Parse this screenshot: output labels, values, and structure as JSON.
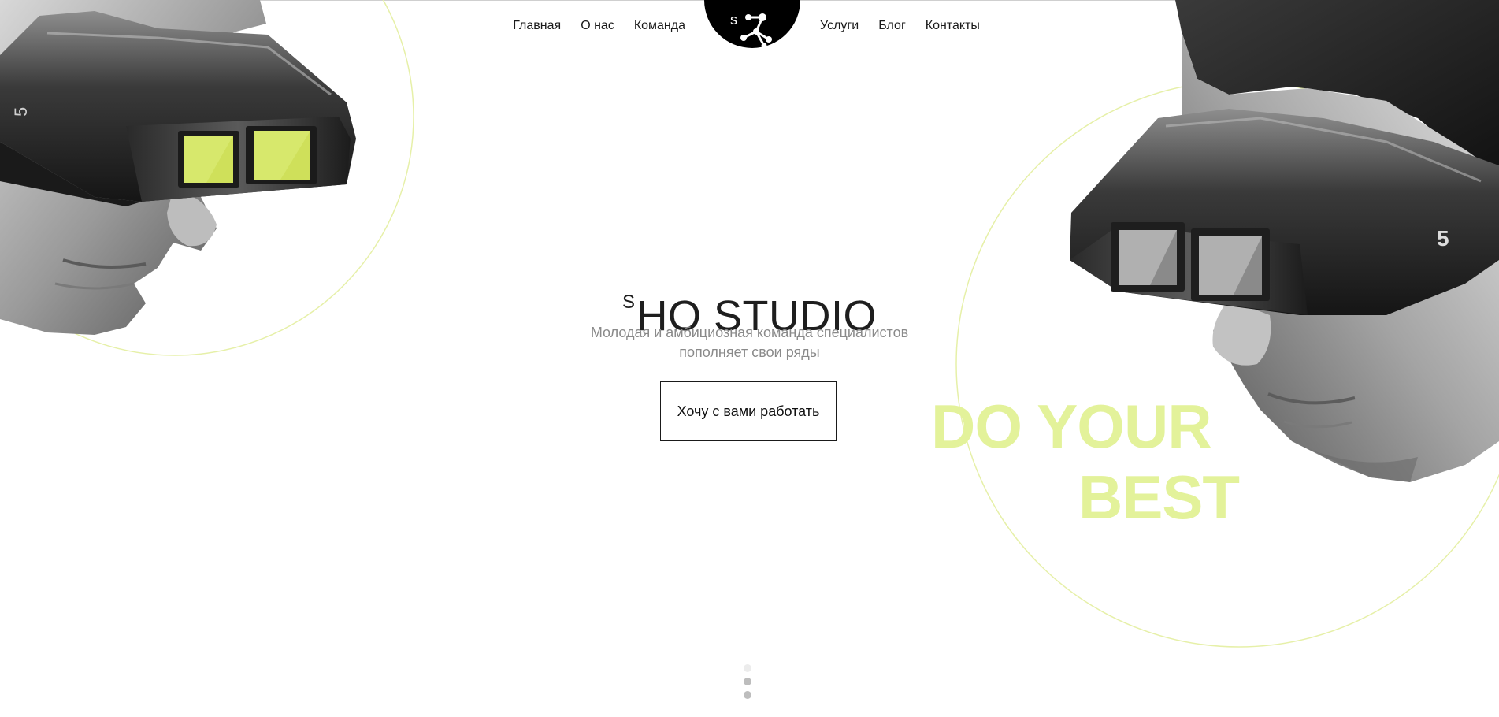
{
  "nav": {
    "left": [
      {
        "label": "Главная"
      },
      {
        "label": "О нас"
      },
      {
        "label": "Команда"
      }
    ],
    "right": [
      {
        "label": "Услуги"
      },
      {
        "label": "Блог"
      },
      {
        "label": "Контакты"
      }
    ]
  },
  "logo": {
    "letter": "s",
    "icon": "network-nodes-icon"
  },
  "hero": {
    "title_sup": "S",
    "title": "HO STUDIO",
    "subtitle_line1": "Молодая и амбициозная команда специалистов",
    "subtitle_line2": "пополняет свои ряды",
    "cta_label": "Хочу с вами работать"
  },
  "slogan": {
    "line1": "DO YOUR",
    "line2": "BEST"
  },
  "pager": {
    "count": 3,
    "active_index": 0
  },
  "colors": {
    "accent": "#e3f29a",
    "accent_line": "#e6f0a8",
    "text": "#1a1a1a",
    "muted": "#8a8a8a",
    "lens": "#cfe05a"
  }
}
